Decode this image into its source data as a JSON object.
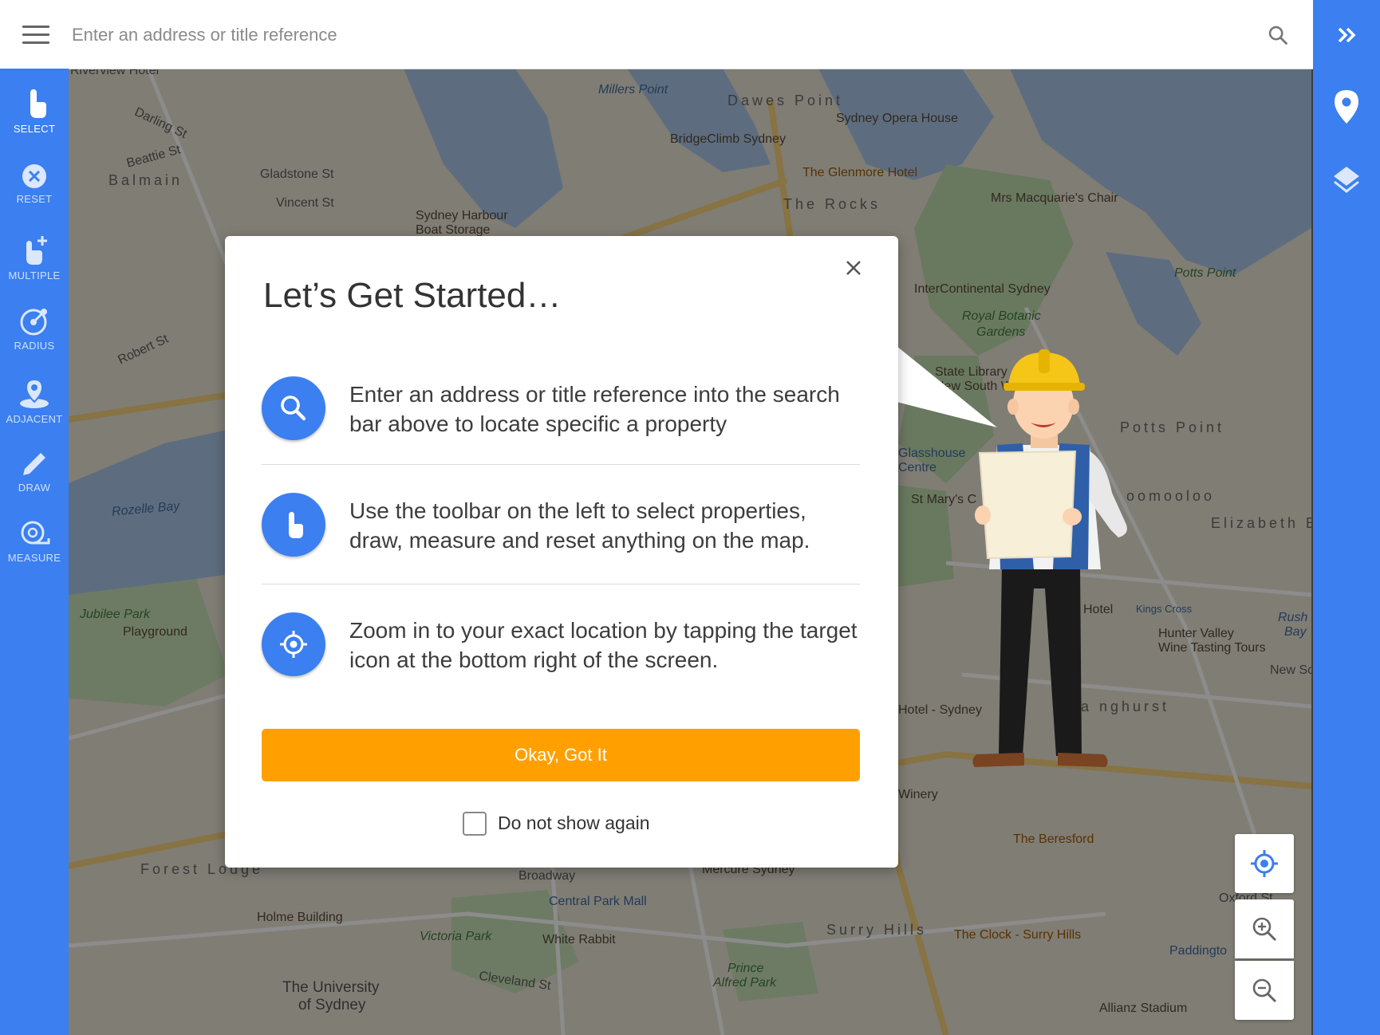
{
  "search": {
    "placeholder": "Enter an address or title reference"
  },
  "toolbar": {
    "items": [
      {
        "label": "SELECT",
        "icon": "touch-icon"
      },
      {
        "label": "RESET",
        "icon": "reset-icon"
      },
      {
        "label": "MULTIPLE",
        "icon": "multiple-touch-icon"
      },
      {
        "label": "RADIUS",
        "icon": "radius-icon"
      },
      {
        "label": "ADJACENT",
        "icon": "adjacent-pin-icon"
      },
      {
        "label": "DRAW",
        "icon": "pencil-icon"
      },
      {
        "label": "MEASURE",
        "icon": "measure-icon"
      }
    ]
  },
  "rightbar": {
    "icons": [
      "double-chevron-right-icon",
      "location-pin-icon",
      "layers-icon"
    ]
  },
  "map_controls": [
    "target-icon",
    "zoom-in-icon",
    "zoom-out-icon"
  ],
  "map": {
    "labels": {
      "riverview_hotel": "Riverview Hotel",
      "millers_point": "Millers Point",
      "dawes_point": "Dawes Point",
      "opera_house": "Sydney Opera House",
      "bridgeclimb": "BridgeClimb Sydney",
      "glenmore": "The Glenmore Hotel",
      "the_rocks": "The Rocks",
      "mrs_macquaries": "Mrs Macquarie's Chair",
      "balmain": "Balmain",
      "darling_st": "Darling St",
      "beattie_st": "Beattie St",
      "gladstone_st": "Gladstone St",
      "vincent_st": "Vincent St",
      "harbour_boat": "Sydney Harbour",
      "harbour_boat2": "Boat Storage",
      "potts_point_park": "Potts Point",
      "intercontinental": "InterContinental Sydney",
      "royal_botanic": "Royal Botanic",
      "royal_botanic2": "Gardens",
      "state_library": "State Library",
      "state_library2": "New South W",
      "potts_point": "Potts Point",
      "glasshouse": "Glasshouse",
      "glasshouse2": "Centre",
      "st_marys": "St Mary's C",
      "woolloomooloo": "oomooloo",
      "elizabeth_bay": "Elizabeth B",
      "rozelle_bay": "Rozelle Bay",
      "robert_st": "Robert St",
      "jubilee_park": "Jubilee Park",
      "playground": "Playground",
      "hotel": "Hotel",
      "kings_cross": "Kings Cross",
      "rush_bay": "Rush",
      "rush_bay2": "Bay",
      "hunter_valley": "Hunter Valley",
      "hunter_valley2": "Wine Tasting Tours",
      "hotel_sydney": "Hotel - Sydney",
      "darlinghurst": "Da   nghurst",
      "winery": "Winery",
      "beresford": "The Beresford",
      "forest_lodge": "Forest Lodge",
      "broadway": "Broadway",
      "mercure": "Mercure Sydney",
      "central_park": "Central Park Mall",
      "holme": "Holme Building",
      "victoria_park": "Victoria Park",
      "white_rabbit": "White Rabbit",
      "surry_hills": "Surry Hills",
      "clock": "The Clock - Surry Hills",
      "paddington": "Paddingto",
      "uni_sydney": "The University",
      "uni_sydney2": "of Sydney",
      "prince_alfred": "Prince",
      "prince_alfred2": "Alfred Park",
      "cleveland_st": "Cleveland St",
      "allianz": "Allianz Stadium",
      "oxford_st": "Oxford St",
      "new_south": "New Sou"
    }
  },
  "dialog": {
    "title": "Let’s Get Started…",
    "steps": [
      {
        "icon": "search-icon",
        "text": "Enter an address or title reference into the search bar above to locate specific a property"
      },
      {
        "icon": "touch-icon",
        "text": "Use the toolbar on the left to select properties, draw, measure and reset anything on the map."
      },
      {
        "icon": "target-icon",
        "text": "Zoom in to your exact location by tapping the target icon at the bottom right of the screen."
      }
    ],
    "ok_label": "Okay, Got It",
    "dont_show_label": "Do not show again",
    "dont_show_checked": false
  },
  "colors": {
    "primary": "#3b7ff0",
    "accent": "#ffa000"
  }
}
